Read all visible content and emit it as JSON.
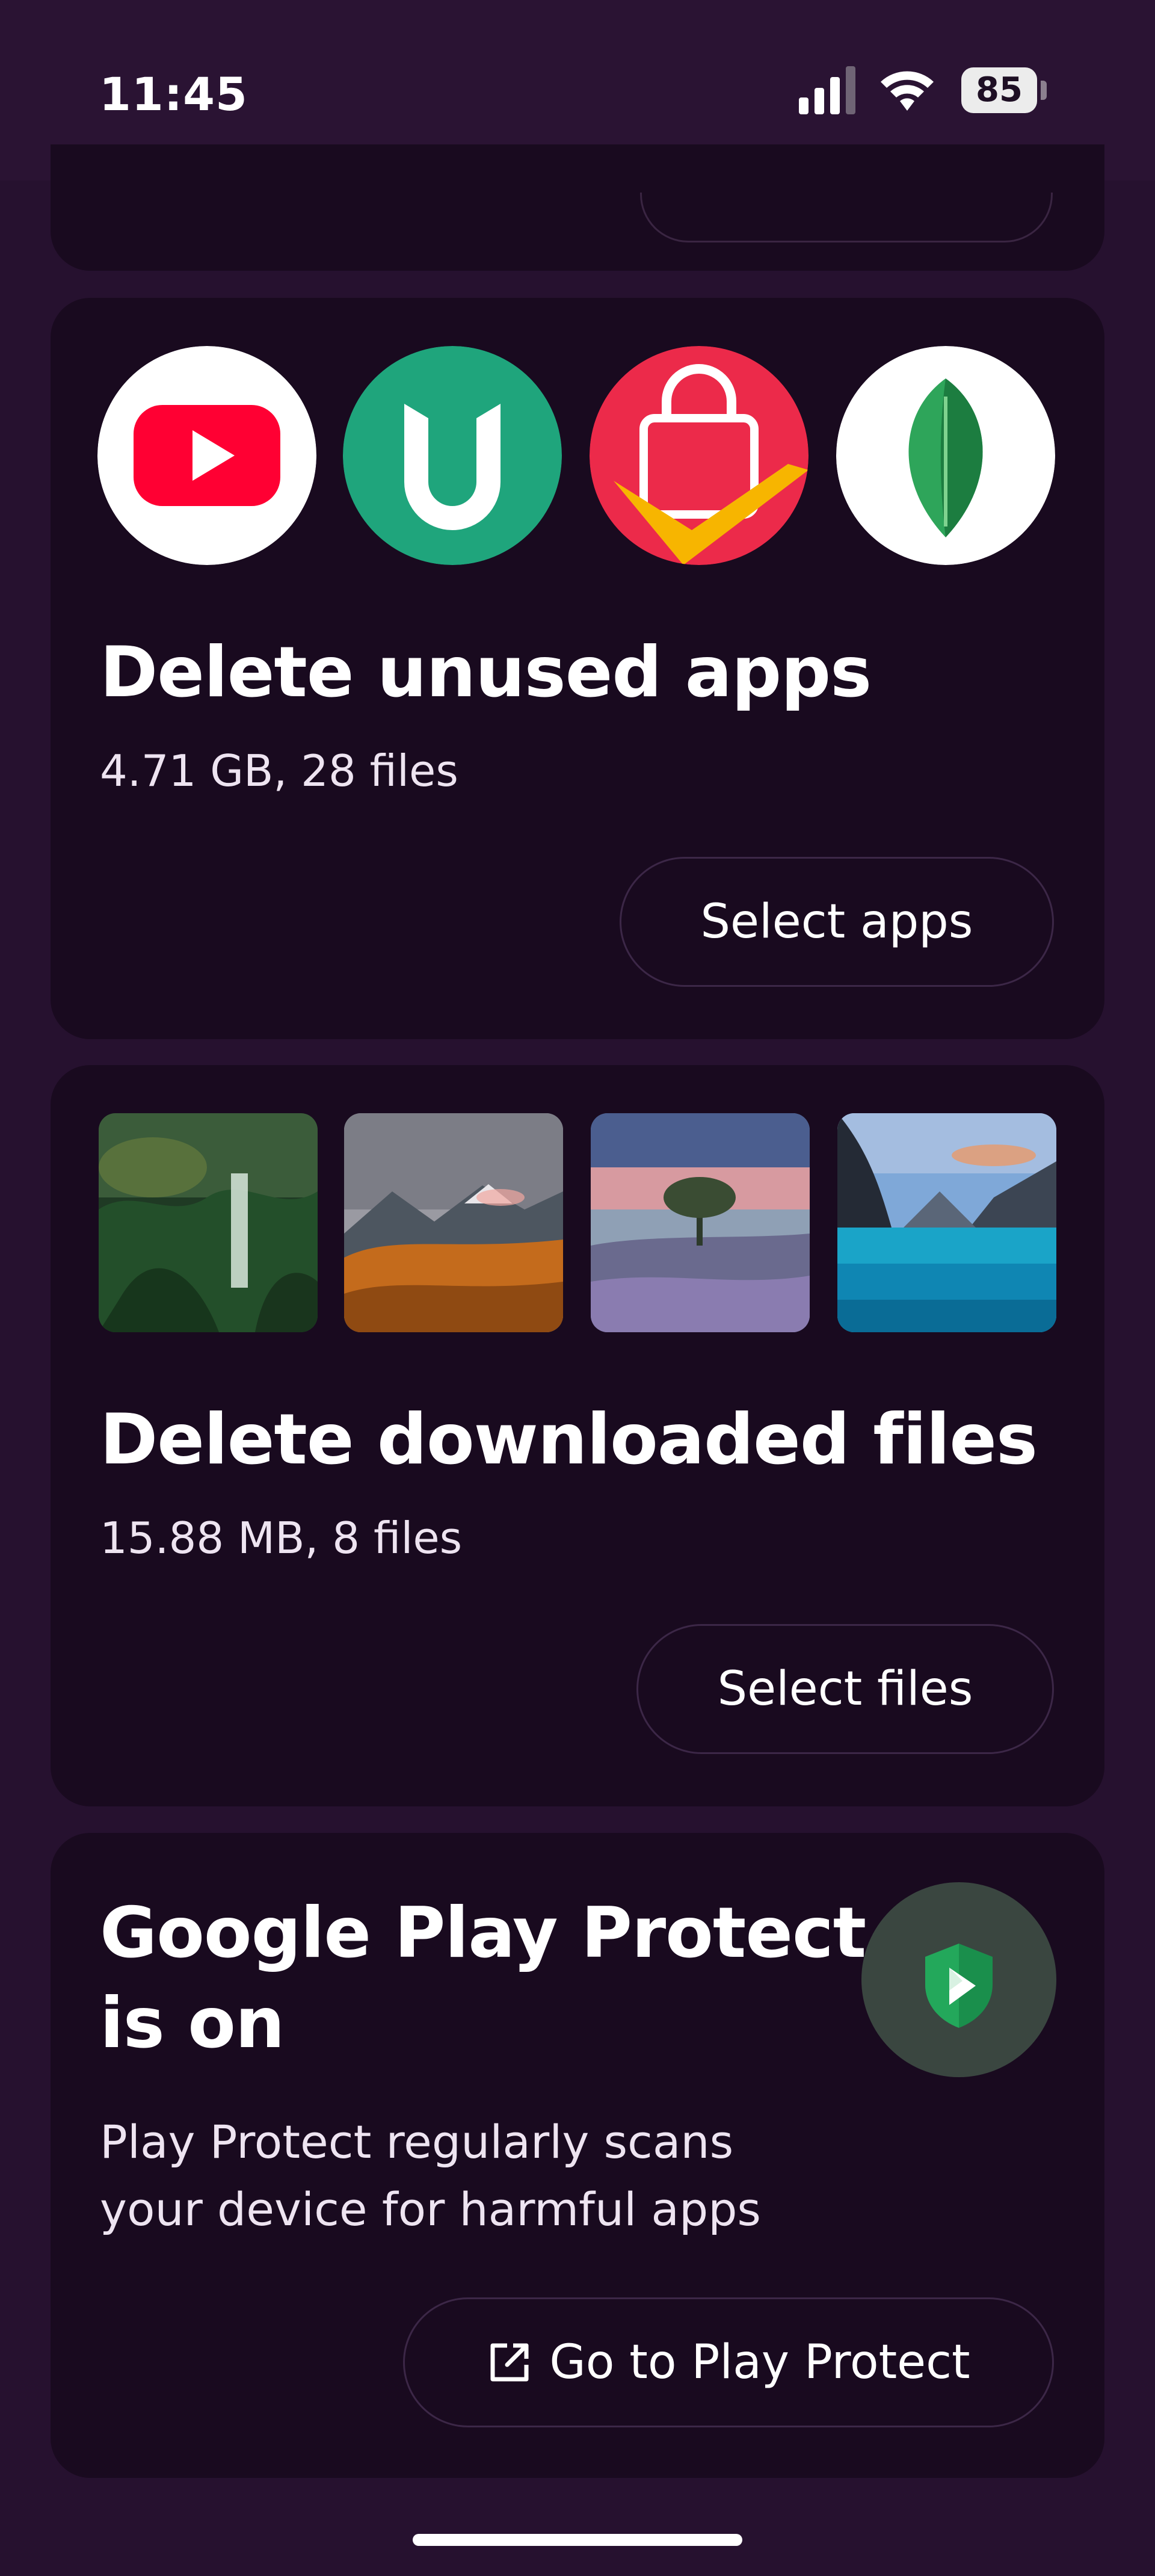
{
  "status_bar": {
    "time": "11:45",
    "battery": "85"
  },
  "apps_card": {
    "icons": [
      "youtube-icon",
      "mi-home-icon",
      "shopping-bag-icon",
      "snapseed-icon"
    ],
    "title": "Delete unused apps",
    "subtitle": "4.71 GB, 28 files",
    "button_label": "Select apps"
  },
  "files_card": {
    "title": "Delete downloaded files",
    "subtitle": "15.88 MB, 8 files",
    "button_label": "Select files"
  },
  "protect_card": {
    "title_line1": "Google Play Protect",
    "title_line2": "is on",
    "description_line1": "Play Protect regularly scans",
    "description_line2": "your device for harmful apps",
    "button_label": "Go to Play Protect",
    "icon": "play-protect-shield-icon"
  },
  "colors": {
    "background": "#26112f",
    "card": "#190a1f",
    "youtube_red": "#ff0033",
    "mi_home_green": "#1fa57c",
    "shop_red": "#ec2a4a",
    "snapseed_green": "#2ea55a"
  }
}
